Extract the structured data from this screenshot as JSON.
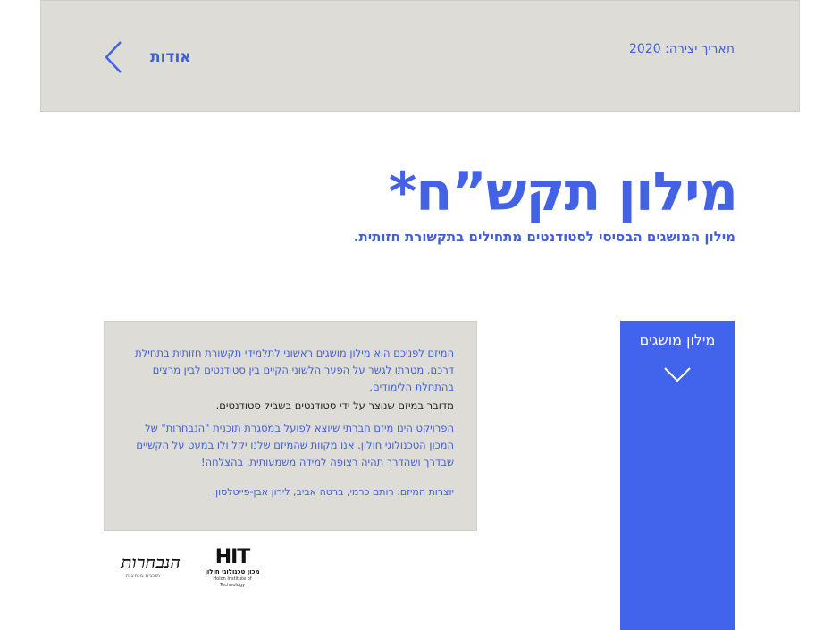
{
  "header": {
    "creation_date": "תאריך יצירה: 2020",
    "about_label": "אודות"
  },
  "hero": {
    "title": "מילון תקש”ח*",
    "subtitle": "מילון המושגים הבסיסי לסטודנטים מתחילים בתקשורת חזותית."
  },
  "info": {
    "intro": "המיזם לפניכם הוא מילון מושגים ראשוני לתלמידי תקשורת חזותית בתחילת דרכם. מטרתו לגשר על הפער הלשוני הקיים בין סטודנטים לבין מרצים בהתחלת הלימודים.",
    "highlight": "מדובר במיזם שנוצר על ידי סטודנטים בשביל סטודנטים.",
    "project": "הפרויקט הינו מיזם חברתי שיוצא לפועל במסגרת תוכנית \"הנבחרות\" של המכון הטכנולוגי חולון. אנו מקוות שהמיזם שלנו יקל ולו במעט על הקשיים שבדרך ושהדרך תהיה רצופה למידה משמעותית. בהצלחה!",
    "credits": "יוצרות המיזם: רותם כרמי, ברטה אביב, לירון אבן-פייטלסון."
  },
  "glossary": {
    "label": "מילון מושגים",
    "icon": "chevron-down-icon"
  },
  "logos": {
    "hanhavrut": {
      "word": "הנבחרות",
      "tag": "תוכנית מנהיגות"
    },
    "hit": {
      "mark": "HIT",
      "name": "מכון טכנולוגי חולון",
      "en": "Holon Institute of Technology"
    }
  },
  "colors": {
    "accent": "#4263eb",
    "text_blue": "#3f5fd8",
    "panel_bg": "#dedcd6"
  }
}
